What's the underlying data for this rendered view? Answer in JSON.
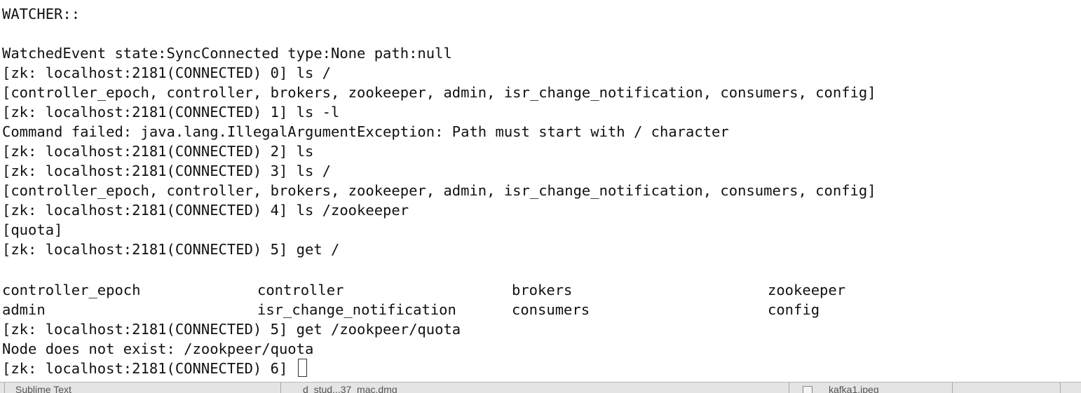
{
  "terminal": {
    "lines": [
      "WATCHER::",
      "",
      "WatchedEvent state:SyncConnected type:None path:null",
      "[zk: localhost:2181(CONNECTED) 0] ls /",
      "[controller_epoch, controller, brokers, zookeeper, admin, isr_change_notification, consumers, config]",
      "[zk: localhost:2181(CONNECTED) 1] ls -l",
      "Command failed: java.lang.IllegalArgumentException: Path must start with / character",
      "[zk: localhost:2181(CONNECTED) 2] ls",
      "[zk: localhost:2181(CONNECTED) 3] ls /",
      "[controller_epoch, controller, brokers, zookeeper, admin, isr_change_notification, consumers, config]",
      "[zk: localhost:2181(CONNECTED) 4] ls /zookeeper",
      "[quota]",
      "[zk: localhost:2181(CONNECTED) 5] get /"
    ],
    "grid": [
      [
        "controller_epoch",
        "controller",
        "brokers",
        "zookeeper"
      ],
      [
        "admin",
        "isr_change_notification",
        "consumers",
        "config"
      ]
    ],
    "after_lines": [
      "[zk: localhost:2181(CONNECTED) 5] get /zookpeer/quota",
      "Node does not exist: /zookpeer/quota"
    ],
    "prompt": "[zk: localhost:2181(CONNECTED) 6] "
  },
  "dock": {
    "item1": "Sublime Text",
    "item2": "d_stud...37_mac.dmg",
    "item3": "kafka1.jpeg"
  }
}
